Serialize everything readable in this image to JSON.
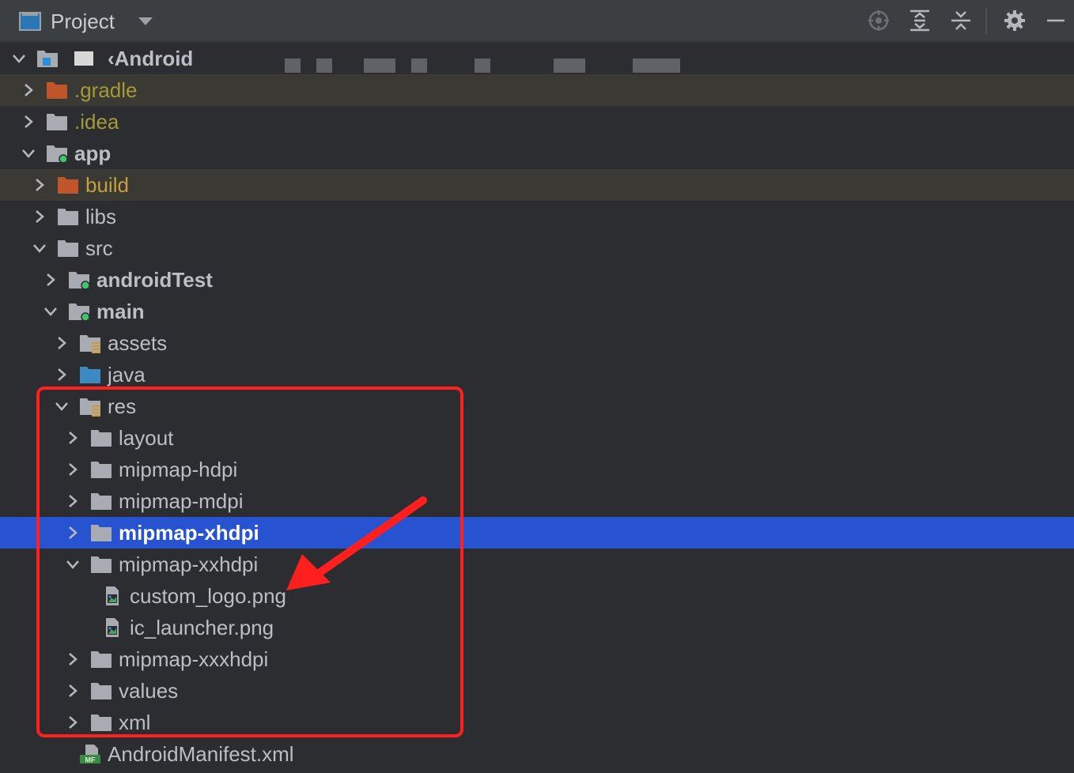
{
  "header": {
    "title": "Project",
    "tools": [
      "locate-icon",
      "expand-all-icon",
      "collapse-all-icon",
      "gear-icon",
      "minimize-icon"
    ]
  },
  "tree": {
    "root": "‹Android",
    "rows": [
      {
        "label": ".gradle",
        "depth": 1,
        "expanded": false,
        "icon": "folder-excluded",
        "style": "yellow",
        "excluded": true
      },
      {
        "label": ".idea",
        "depth": 1,
        "expanded": false,
        "icon": "folder",
        "style": "yellow"
      },
      {
        "label": "app",
        "depth": 1,
        "expanded": true,
        "icon": "module-folder",
        "style": "bold"
      },
      {
        "label": "build",
        "depth": 2,
        "expanded": false,
        "icon": "folder-excluded",
        "style": "orange",
        "excluded": true
      },
      {
        "label": "libs",
        "depth": 2,
        "expanded": false,
        "icon": "folder",
        "style": "normal"
      },
      {
        "label": "src",
        "depth": 2,
        "expanded": true,
        "icon": "folder",
        "style": "normal"
      },
      {
        "label": "androidTest",
        "depth": 3,
        "expanded": false,
        "icon": "module-folder",
        "style": "bold"
      },
      {
        "label": "main",
        "depth": 3,
        "expanded": true,
        "icon": "module-folder",
        "style": "bold"
      },
      {
        "label": "assets",
        "depth": 4,
        "expanded": false,
        "icon": "resource-folder",
        "style": "normal"
      },
      {
        "label": "java",
        "depth": 4,
        "expanded": false,
        "icon": "source-folder",
        "style": "normal"
      },
      {
        "label": "res",
        "depth": 4,
        "expanded": true,
        "icon": "resource-folder",
        "style": "normal"
      },
      {
        "label": "layout",
        "depth": 5,
        "expanded": false,
        "icon": "folder",
        "style": "normal"
      },
      {
        "label": "mipmap-hdpi",
        "depth": 5,
        "expanded": false,
        "icon": "folder",
        "style": "normal"
      },
      {
        "label": "mipmap-mdpi",
        "depth": 5,
        "expanded": false,
        "icon": "folder",
        "style": "normal"
      },
      {
        "label": "mipmap-xhdpi",
        "depth": 5,
        "expanded": false,
        "icon": "folder",
        "style": "white",
        "selected": true
      },
      {
        "label": "mipmap-xxhdpi",
        "depth": 5,
        "expanded": true,
        "icon": "folder",
        "style": "normal"
      },
      {
        "label": "custom_logo.png",
        "depth": 6,
        "leaf": true,
        "icon": "image-file",
        "style": "normal"
      },
      {
        "label": "ic_launcher.png",
        "depth": 6,
        "leaf": true,
        "icon": "image-file",
        "style": "normal"
      },
      {
        "label": "mipmap-xxxhdpi",
        "depth": 5,
        "expanded": false,
        "icon": "folder",
        "style": "normal"
      },
      {
        "label": "values",
        "depth": 5,
        "expanded": false,
        "icon": "folder",
        "style": "normal"
      },
      {
        "label": "xml",
        "depth": 5,
        "expanded": false,
        "icon": "folder",
        "style": "normal"
      },
      {
        "label": "AndroidManifest.xml",
        "depth": 4,
        "leaf": true,
        "icon": "manifest-file",
        "style": "normal"
      }
    ]
  },
  "colors": {
    "background": "#2b2d30",
    "selection": "#2753d0",
    "excluded_row": "#3a3933",
    "folder": "#a8acb2",
    "excluded_folder": "#c0542a",
    "source_folder": "#3b8ac4",
    "module_dot": "#3ec66b",
    "annotation": "#ff1f1f"
  }
}
